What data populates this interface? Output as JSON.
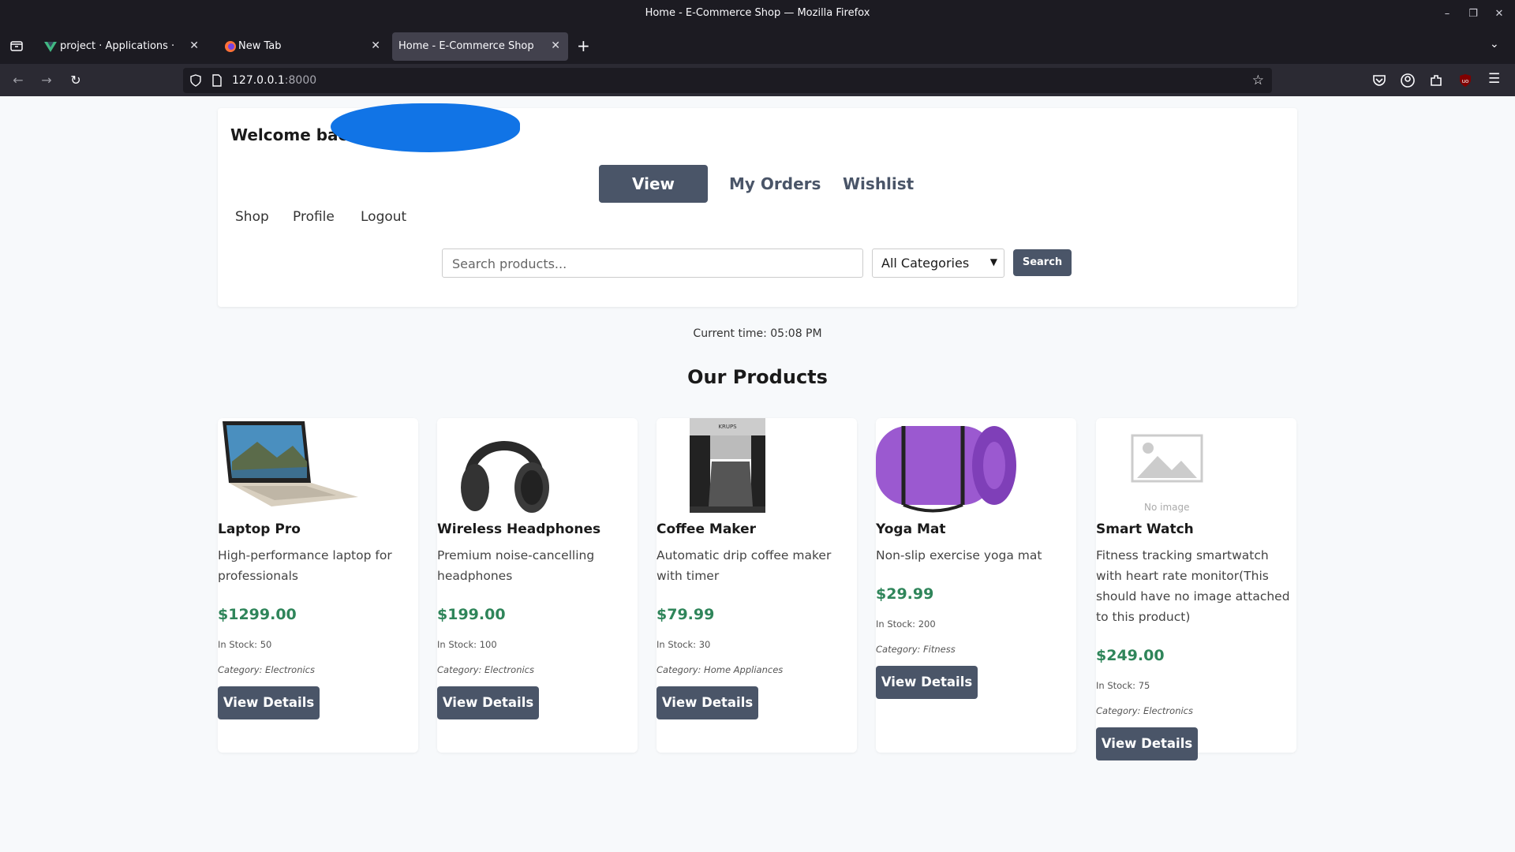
{
  "browser": {
    "window_title": "Home - E-Commerce Shop — Mozilla Firefox",
    "tabs": [
      {
        "label": "project · Applications · User",
        "active": false
      },
      {
        "label": "New Tab",
        "active": false
      },
      {
        "label": "Home - E-Commerce Shop",
        "active": true
      }
    ],
    "url_host": "127.0.0.1",
    "url_port": ":8000"
  },
  "header": {
    "welcome": "Welcome back",
    "nav_buttons": {
      "cart": "View Cart",
      "orders": "My Orders",
      "wishlist": "Wishlist"
    },
    "links": {
      "shop": "Shop",
      "profile": "Profile",
      "logout": "Logout"
    },
    "search": {
      "placeholder": "Search products...",
      "category": "All Categories",
      "button": "Search"
    }
  },
  "time_text": "Current time: 05:08 PM",
  "section_title": "Our Products",
  "products": [
    {
      "name": "Laptop Pro",
      "desc": "High-performance laptop for professionals",
      "price": "$1299.00",
      "stock": "In Stock: 50",
      "category": "Category: Electronics",
      "button": "View Details",
      "image": "laptop"
    },
    {
      "name": "Wireless Headphones",
      "desc": "Premium noise-cancelling headphones",
      "price": "$199.00",
      "stock": "In Stock: 100",
      "category": "Category: Electronics",
      "button": "View Details",
      "image": "headphones"
    },
    {
      "name": "Coffee Maker",
      "desc": "Automatic drip coffee maker with timer",
      "price": "$79.99",
      "stock": "In Stock: 30",
      "category": "Category: Home Appliances",
      "button": "View Details",
      "image": "coffee-maker",
      "brand_mark": "KRUPS"
    },
    {
      "name": "Yoga Mat",
      "desc": "Non-slip exercise yoga mat",
      "price": "$29.99",
      "stock": "In Stock: 200",
      "category": "Category: Fitness",
      "button": "View Details",
      "image": "yoga-mat"
    },
    {
      "name": "Smart Watch",
      "desc": "Fitness tracking smartwatch with heart rate monitor(This should have no image attached to this product)",
      "price": "$249.00",
      "stock": "In Stock: 75",
      "category": "Category: Electronics",
      "button": "View Details",
      "image": "no-image",
      "no_image_label": "No image"
    }
  ]
}
